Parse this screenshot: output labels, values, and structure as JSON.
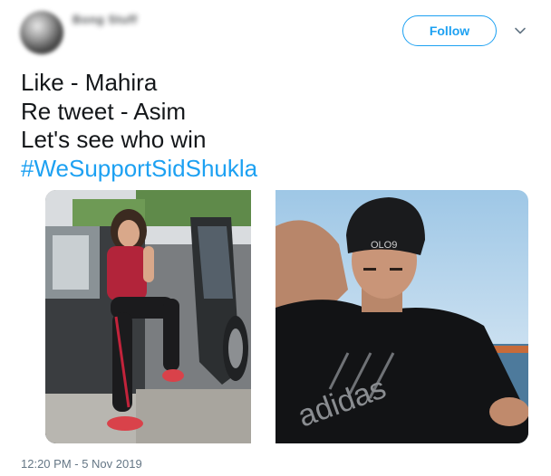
{
  "header": {
    "display_name": "Bong Stuff",
    "follow_label": "Follow"
  },
  "tweet": {
    "lines": [
      "Like - Mahira",
      "Re tweet - Asim",
      "Let's see who win"
    ],
    "hashtag": "#WeSupportSidShukla",
    "timestamp": "12:20 PM - 5 Nov 2019"
  },
  "photos": [
    {
      "subject": "woman-in-car-photo"
    },
    {
      "subject": "man-in-cap-photo",
      "cap_text": "OLO9",
      "shirt_text": "adidas"
    }
  ],
  "colors": {
    "accent": "#1da1f2",
    "text": "#14171a",
    "muted": "#657786"
  }
}
